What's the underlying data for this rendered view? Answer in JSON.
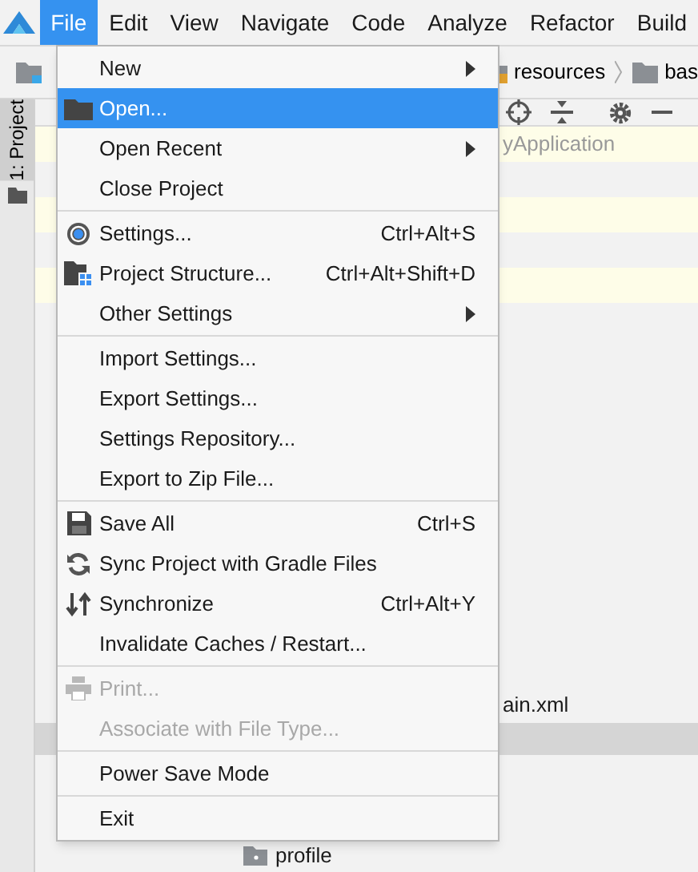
{
  "menu_bar": [
    {
      "label": "File",
      "selected": true
    },
    {
      "label": "Edit",
      "selected": false
    },
    {
      "label": "View",
      "selected": false
    },
    {
      "label": "Navigate",
      "selected": false
    },
    {
      "label": "Code",
      "selected": false
    },
    {
      "label": "Analyze",
      "selected": false
    },
    {
      "label": "Refactor",
      "selected": false
    },
    {
      "label": "Build",
      "selected": false
    }
  ],
  "breadcrumb": [
    {
      "kind": "module"
    },
    {
      "label": "resources",
      "kind": "resources"
    },
    {
      "label": "bas",
      "kind": "folder"
    }
  ],
  "side_tab": {
    "label": "1: Project",
    "selected": true
  },
  "tree": [
    {
      "label": "yApplication",
      "kind": "root"
    },
    {
      "label": "ain.xml",
      "kind": "file"
    },
    {
      "label": "profile",
      "kind": "folder"
    }
  ],
  "file_menu": {
    "groups": [
      [
        {
          "label": "New",
          "kind": "plain",
          "submenu": true,
          "selected": false,
          "disabled": false
        },
        {
          "label": "Open...",
          "kind": "folder",
          "selected": true,
          "disabled": false
        },
        {
          "label": "Open Recent",
          "kind": "plain",
          "submenu": true,
          "selected": false,
          "disabled": false
        },
        {
          "label": "Close Project",
          "kind": "plain",
          "selected": false,
          "disabled": false
        }
      ],
      [
        {
          "label": "Settings...",
          "kind": "settings",
          "shortcut": "Ctrl+Alt+S",
          "selected": false,
          "disabled": false
        },
        {
          "label": "Project Structure...",
          "kind": "structure",
          "shortcut": "Ctrl+Alt+Shift+D",
          "selected": false,
          "disabled": false
        },
        {
          "label": "Other Settings",
          "kind": "plain",
          "submenu": true,
          "selected": false,
          "disabled": false
        }
      ],
      [
        {
          "label": "Import Settings...",
          "kind": "plain",
          "selected": false,
          "disabled": false
        },
        {
          "label": "Export Settings...",
          "kind": "plain",
          "selected": false,
          "disabled": false
        },
        {
          "label": "Settings Repository...",
          "kind": "plain",
          "selected": false,
          "disabled": false
        },
        {
          "label": "Export to Zip File...",
          "kind": "plain",
          "selected": false,
          "disabled": false
        }
      ],
      [
        {
          "label": "Save All",
          "kind": "save",
          "shortcut": "Ctrl+S",
          "selected": false,
          "disabled": false
        },
        {
          "label": "Sync Project with Gradle Files",
          "kind": "sync",
          "selected": false,
          "disabled": false
        },
        {
          "label": "Synchronize",
          "kind": "updown",
          "shortcut": "Ctrl+Alt+Y",
          "selected": false,
          "disabled": false
        },
        {
          "label": "Invalidate Caches / Restart...",
          "kind": "plain",
          "selected": false,
          "disabled": false
        }
      ],
      [
        {
          "label": "Print...",
          "kind": "print",
          "selected": false,
          "disabled": true
        },
        {
          "label": "Associate with File Type...",
          "kind": "plain",
          "selected": false,
          "disabled": true
        }
      ],
      [
        {
          "label": "Power Save Mode",
          "kind": "plain",
          "selected": false,
          "disabled": false
        }
      ],
      [
        {
          "label": "Exit",
          "kind": "plain",
          "selected": false,
          "disabled": false
        }
      ]
    ]
  }
}
